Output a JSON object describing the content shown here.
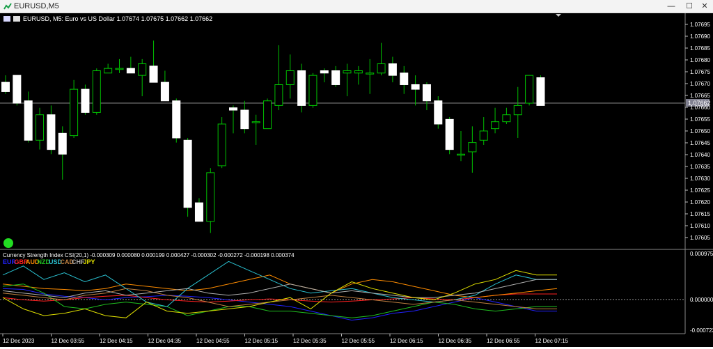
{
  "window": {
    "title": "EURUSD,M5",
    "minimize_glyph": "—",
    "maximize_glyph": "☐",
    "close_glyph": "✕"
  },
  "chart": {
    "symbol_line": "EURUSD, M5:  Euro vs US Dollar  1.07674 1.07675 1.07662 1.07662",
    "current_price_label": "1.07662",
    "price_ticks": [
      "1.07695",
      "1.07690",
      "1.07685",
      "1.07680",
      "1.07675",
      "1.07670",
      "1.07665",
      "1.07660",
      "1.07655",
      "1.07650",
      "1.07645",
      "1.07640",
      "1.07635",
      "1.07630",
      "1.07625",
      "1.07620",
      "1.07615",
      "1.07610",
      "1.07605"
    ],
    "candle_color": "#ffffff",
    "wick_color": "#00c000"
  },
  "indicator": {
    "title": "Currency Strength Index CSI(20,1) -0.000309 0.000080 0.000199 0.000427 -0.000302 -0.000272 -0.000198 0.000374",
    "currencies": [
      {
        "code": "EUR",
        "color": "#2222ff"
      },
      {
        "code": "GBP",
        "color": "#ff2020"
      },
      {
        "code": "AUD",
        "color": "#ff8c00"
      },
      {
        "code": "NZD",
        "color": "#20c020"
      },
      {
        "code": "USD",
        "color": "#2ac0d0"
      },
      {
        "code": "CAD",
        "color": "#c08040"
      },
      {
        "code": "CHF",
        "color": "#b0b0b0"
      },
      {
        "code": "JPY",
        "color": "#e0e000"
      }
    ],
    "axis_ticks": [
      "0.000975",
      "0.000000",
      "-0.000723"
    ]
  },
  "time_axis": [
    "12 Dec 2023",
    "12 Dec 03:55",
    "12 Dec 04:15",
    "12 Dec 04:35",
    "12 Dec 04:55",
    "12 Dec 05:15",
    "12 Dec 05:35",
    "12 Dec 05:55",
    "12 Dec 06:15",
    "12 Dec 06:35",
    "12 Dec 06:55",
    "12 Dec 07:15"
  ],
  "chart_data": {
    "type": "candlestick",
    "symbol": "EURUSD",
    "timeframe": "M5",
    "ylim": [
      1.07602,
      1.077
    ],
    "candles": [
      [
        1.07672,
        1.07675,
        1.07667,
        1.07668
      ],
      [
        1.07675,
        1.07675,
        1.07662,
        1.07663
      ],
      [
        1.07664,
        1.07668,
        1.07646,
        1.07647
      ],
      [
        1.07647,
        1.07661,
        1.07643,
        1.07658
      ],
      [
        1.07658,
        1.07662,
        1.07641,
        1.07643
      ],
      [
        1.0765,
        1.07653,
        1.0763,
        1.07641
      ],
      [
        1.07649,
        1.07673,
        1.07648,
        1.07669
      ],
      [
        1.07669,
        1.07671,
        1.07658,
        1.07659
      ],
      [
        1.07659,
        1.07678,
        1.07658,
        1.07677
      ],
      [
        1.07676,
        1.0768,
        1.07676,
        1.07678
      ],
      [
        1.07678,
        1.07682,
        1.07676,
        1.07678
      ],
      [
        1.07678,
        1.07683,
        1.07676,
        1.07676
      ],
      [
        1.07675,
        1.07682,
        1.07666,
        1.0768
      ],
      [
        1.07679,
        1.0769,
        1.07679,
        1.07672
      ],
      [
        1.07672,
        1.07677,
        1.07665,
        1.07664
      ],
      [
        1.07664,
        1.07665,
        1.07646,
        1.07648
      ],
      [
        1.07647,
        1.07648,
        1.07614,
        1.07618
      ],
      [
        1.0762,
        1.07622,
        1.07612,
        1.07612
      ],
      [
        1.07612,
        1.07635,
        1.07607,
        1.07633
      ],
      [
        1.07636,
        1.07657,
        1.07635,
        1.07654
      ],
      [
        1.07661,
        1.07662,
        1.0765,
        1.0766
      ],
      [
        1.0766,
        1.07664,
        1.0765,
        1.07652
      ],
      [
        1.07655,
        1.07658,
        1.07645,
        1.07655
      ],
      [
        1.07652,
        1.07665,
        1.07652,
        1.07664
      ],
      [
        1.07662,
        1.07688,
        1.0766,
        1.07671
      ],
      [
        1.07671,
        1.07684,
        1.07665,
        1.07677
      ],
      [
        1.07677,
        1.0768,
        1.07659,
        1.07662
      ],
      [
        1.07662,
        1.07676,
        1.07661,
        1.07675
      ],
      [
        1.07677,
        1.07678,
        1.07672,
        1.07676
      ],
      [
        1.07677,
        1.07679,
        1.0767,
        1.07671
      ],
      [
        1.07676,
        1.0768,
        1.07666,
        1.07677
      ],
      [
        1.07676,
        1.07679,
        1.07671,
        1.07677
      ],
      [
        1.07676,
        1.07682,
        1.07667,
        1.07676
      ],
      [
        1.07676,
        1.07689,
        1.07675,
        1.0768
      ],
      [
        1.0768,
        1.07683,
        1.07672,
        1.07675
      ],
      [
        1.07676,
        1.07679,
        1.07667,
        1.07671
      ],
      [
        1.07671,
        1.07675,
        1.07662,
        1.07669
      ],
      [
        1.07671,
        1.07672,
        1.0766,
        1.07664
      ],
      [
        1.07664,
        1.07666,
        1.07652,
        1.07654
      ],
      [
        1.07656,
        1.07657,
        1.07641,
        1.07643
      ],
      [
        1.07641,
        1.07651,
        1.07638,
        1.07641
      ],
      [
        1.07642,
        1.07653,
        1.07633,
        1.07646
      ],
      [
        1.07647,
        1.07657,
        1.07645,
        1.07651
      ],
      [
        1.07652,
        1.07661,
        1.0765,
        1.07655
      ],
      [
        1.07655,
        1.07661,
        1.07654,
        1.07658
      ],
      [
        1.07658,
        1.0767,
        1.07648,
        1.07662
      ],
      [
        1.07663,
        1.07675,
        1.07662,
        1.07675
      ],
      [
        1.07674,
        1.07675,
        1.07662,
        1.07662
      ]
    ],
    "indicator_ylim": [
      -0.000723,
      0.000975
    ],
    "indicator_series": [
      {
        "name": "EUR",
        "values": [
          0.0002,
          0.00018,
          8e-05,
          3e-05,
          0.0,
          -5e-05,
          0.0,
          2e-05,
          5e-05,
          3e-05,
          0.0,
          -5e-05,
          -0.0001,
          -0.00015,
          -0.0002,
          -0.0003,
          -0.0004,
          -0.0005,
          -0.00045,
          -0.00035,
          -0.0003,
          -0.0002,
          -0.0001,
          0.0,
          -0.0001,
          -0.0002,
          -0.0003,
          -0.0003
        ]
      },
      {
        "name": "GBP",
        "values": [
          0.0,
          -5e-05,
          -8e-05,
          -5e-05,
          0.0,
          3e-05,
          5e-05,
          0.0,
          -5e-05,
          -8e-05,
          -0.0001,
          -8e-05,
          -5e-05,
          -3e-05,
          -5e-05,
          -8e-05,
          -0.0001,
          -8e-05,
          -5e-05,
          -3e-05,
          0.0,
          -3e-05,
          -5e-05,
          0.0,
          5e-05,
          8e-05,
          8e-05,
          8e-05
        ]
      },
      {
        "name": "AUD",
        "values": [
          0.0003,
          0.00025,
          0.0002,
          0.00018,
          0.00015,
          0.0002,
          0.0003,
          0.00025,
          0.0002,
          0.00015,
          0.0002,
          0.0003,
          0.0004,
          0.0005,
          0.0003,
          0.0002,
          0.0001,
          0.0003,
          0.0004,
          0.00035,
          0.00025,
          0.00015,
          5e-05,
          0.0,
          5e-05,
          0.0001,
          0.00015,
          0.0002
        ]
      },
      {
        "name": "NZD",
        "values": [
          0.00025,
          0.0003,
          0.0001,
          -0.0002,
          -0.00025,
          -0.00015,
          -0.0001,
          -0.00015,
          -0.0002,
          -0.0004,
          -0.0003,
          -0.0002,
          -0.0002,
          -0.0003,
          -0.0003,
          -0.00035,
          -0.0004,
          -0.00045,
          -0.0004,
          -0.0003,
          -0.0002,
          -0.0001,
          -0.00015,
          -0.00025,
          -0.0003,
          -0.00025,
          -0.0002,
          -0.0002
        ]
      },
      {
        "name": "USD",
        "values": [
          0.0005,
          0.0007,
          0.0004,
          0.00055,
          0.00035,
          0.0005,
          0.0002,
          -0.0001,
          -0.0002,
          0.0002,
          0.0005,
          0.0008,
          0.0006,
          0.0004,
          0.0002,
          0.0001,
          0.00015,
          0.0002,
          0.0001,
          0.0,
          -5e-05,
          -0.0001,
          -5e-05,
          5e-05,
          0.0003,
          0.0005,
          0.0004,
          0.0004
        ]
      },
      {
        "name": "CAD",
        "values": [
          0.0001,
          5e-05,
          0.0,
          -5e-05,
          5e-05,
          0.0001,
          0.0002,
          0.00015,
          5e-05,
          0.0,
          -0.0001,
          -0.0002,
          -0.00015,
          -0.0001,
          -5e-05,
          0.0,
          5e-05,
          0.0,
          -5e-05,
          -0.0001,
          -0.00015,
          -0.0001,
          -5e-05,
          -0.0001,
          -0.00015,
          -0.0002,
          -0.00025,
          -0.00025
        ]
      },
      {
        "name": "CHF",
        "values": [
          0.00015,
          0.0001,
          5e-05,
          0.0,
          0.0001,
          0.00015,
          5e-05,
          0.0001,
          0.00015,
          0.0002,
          0.0001,
          5e-05,
          0.0001,
          0.0002,
          0.0003,
          0.0002,
          0.0001,
          0.00015,
          0.0001,
          5e-05,
          0.0,
          0.0,
          5e-05,
          0.0001,
          0.0002,
          0.0003,
          0.0004,
          0.0004
        ]
      },
      {
        "name": "JPY",
        "values": [
          0.0,
          -0.00025,
          -0.0004,
          -0.00035,
          -0.00025,
          -0.0004,
          -0.00045,
          -0.0001,
          -0.0003,
          -0.00035,
          -0.0003,
          -0.00025,
          -0.0002,
          -0.0001,
          0.0,
          -0.00025,
          0.0001,
          0.00035,
          0.0002,
          0.0001,
          0.0,
          -5e-05,
          0.0001,
          0.0003,
          0.0004,
          0.0006,
          0.0005,
          0.0005
        ]
      }
    ]
  }
}
